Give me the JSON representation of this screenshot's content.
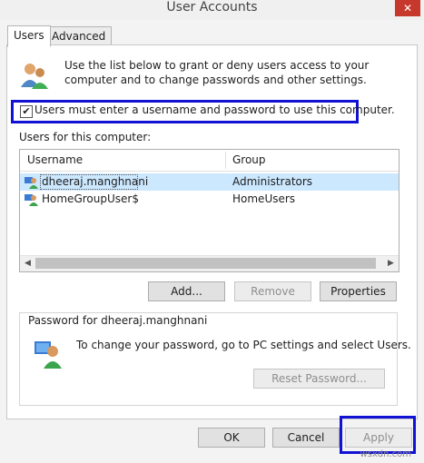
{
  "window": {
    "title": "User Accounts",
    "close_glyph": "✕"
  },
  "tabs": [
    {
      "label": "Users",
      "active": true
    },
    {
      "label": "Advanced",
      "active": false
    }
  ],
  "intro_text": "Use the list below to grant or deny users access to your computer and to change passwords and other settings.",
  "require_login": {
    "checked": true,
    "glyph": "✔",
    "label": "Users must enter a username and password to use this computer."
  },
  "users_list": {
    "label": "Users for this computer:",
    "columns": [
      "Username",
      "Group"
    ],
    "rows": [
      {
        "username": "dheeraj.manghnani",
        "group": "Administrators",
        "selected": true
      },
      {
        "username": "HomeGroupUser$",
        "group": "HomeUsers",
        "selected": false
      }
    ]
  },
  "scroll": {
    "left_arrow": "◀",
    "right_arrow": "▶"
  },
  "buttons": {
    "add": "Add...",
    "remove": "Remove",
    "properties": "Properties",
    "reset_password": "Reset Password...",
    "ok": "OK",
    "cancel": "Cancel",
    "apply": "Apply"
  },
  "password_group": {
    "label": "Password for dheeraj.manghnani",
    "text": "To change your password, go to PC settings and select Users."
  },
  "watermark": "wsxdn.com",
  "icons": {
    "users": "users-icon",
    "user_row": "user-icon",
    "password": "password-user-icon"
  },
  "colors": {
    "highlight": "#1212d4",
    "selection": "#cce8ff",
    "close": "#c7382c"
  }
}
